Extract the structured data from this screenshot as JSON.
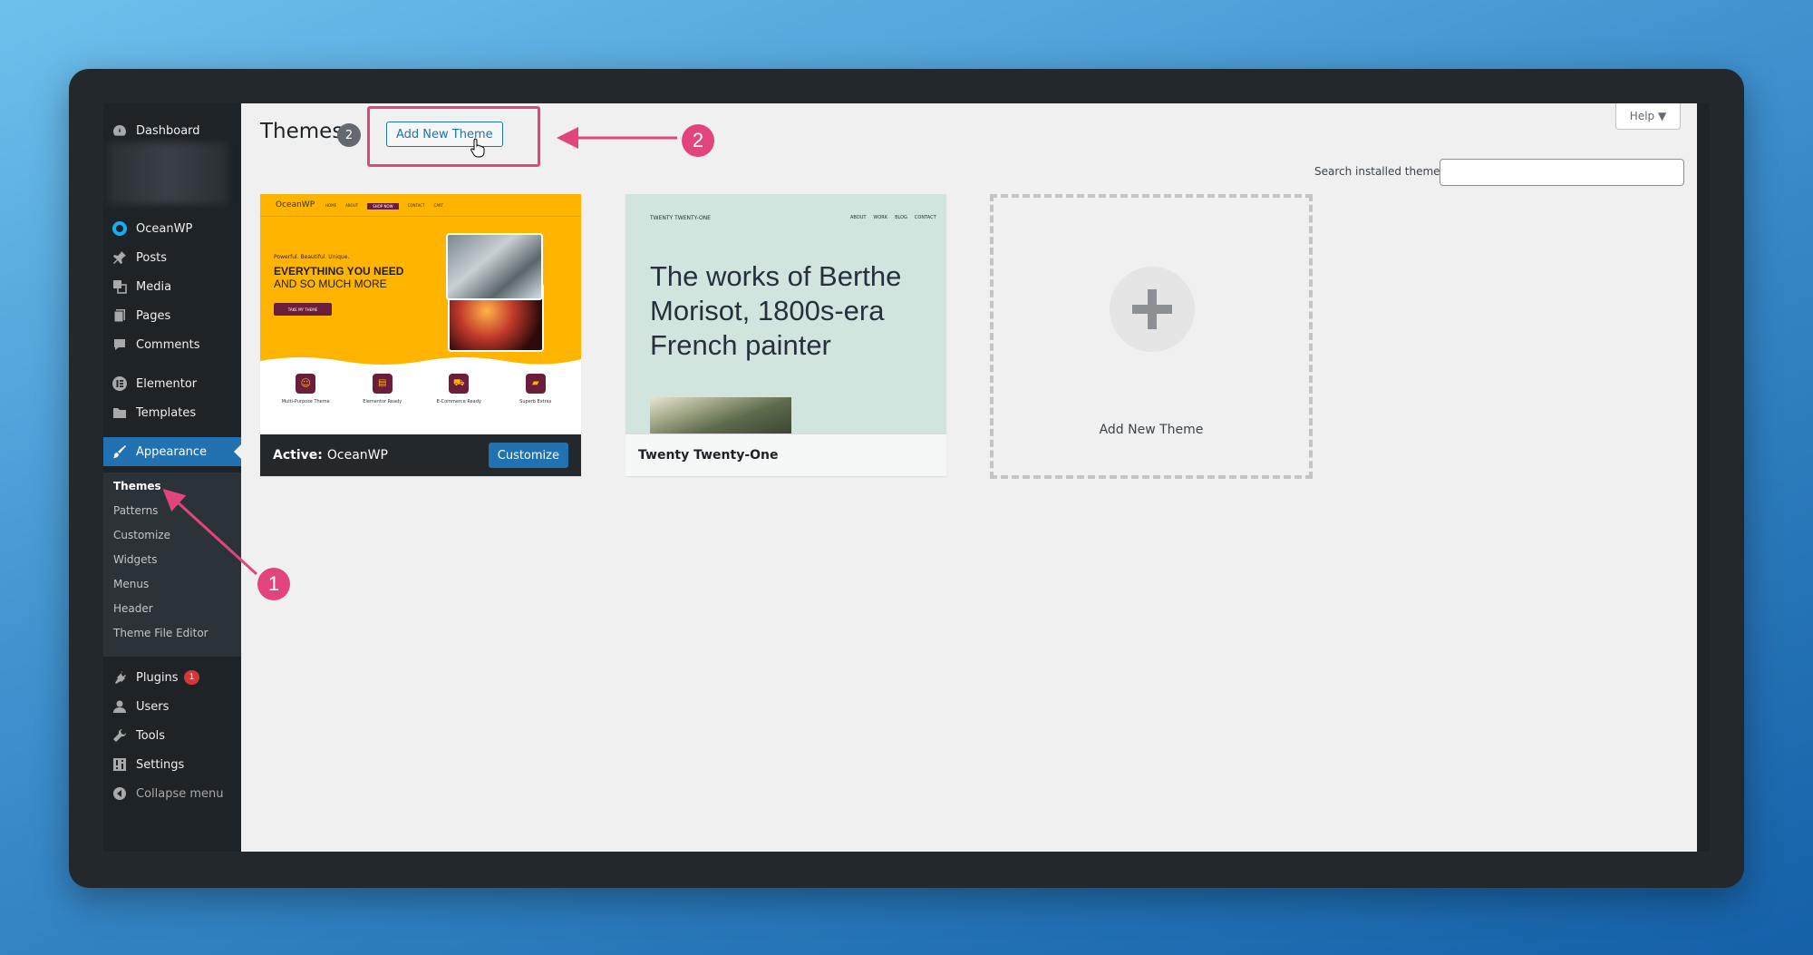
{
  "sidebar": {
    "items": [
      {
        "label": "Dashboard",
        "icon": "dashboard-icon"
      },
      {
        "label": "OceanWP",
        "icon": "oceanwp-icon"
      },
      {
        "label": "Posts",
        "icon": "pin-icon"
      },
      {
        "label": "Media",
        "icon": "media-icon"
      },
      {
        "label": "Pages",
        "icon": "pages-icon"
      },
      {
        "label": "Comments",
        "icon": "comment-icon"
      },
      {
        "label": "Elementor",
        "icon": "elementor-icon"
      },
      {
        "label": "Templates",
        "icon": "folder-icon"
      },
      {
        "label": "Appearance",
        "icon": "brush-icon"
      },
      {
        "label": "Plugins",
        "icon": "plugin-icon",
        "badge": "1"
      },
      {
        "label": "Users",
        "icon": "user-icon"
      },
      {
        "label": "Tools",
        "icon": "wrench-icon"
      },
      {
        "label": "Settings",
        "icon": "settings-icon"
      },
      {
        "label": "Collapse menu",
        "icon": "collapse-icon"
      }
    ],
    "submenu": [
      "Themes",
      "Patterns",
      "Customize",
      "Widgets",
      "Menus",
      "Header",
      "Theme File Editor"
    ]
  },
  "header": {
    "title": "Themes",
    "count": "2",
    "add_button": "Add New Theme",
    "help": "Help ▼",
    "search_label": "Search installed themes",
    "search_placeholder": ""
  },
  "themes": [
    {
      "active_prefix": "Active:",
      "name": "OceanWP",
      "customize": "Customize",
      "preview": {
        "logo": "OceanWP",
        "nav": [
          "HOME",
          "ABOUT",
          "SHOP NOW",
          "CONTACT",
          "CART"
        ],
        "kicker": "Powerful. Beautiful. Unique.",
        "headline1": "EVERYTHING YOU NEED",
        "headline2": "AND SO MUCH MORE",
        "cta": "TAKE MY THEME",
        "features": [
          "Multi-Purpose Theme",
          "Elementor Ready",
          "E-Commerce Ready",
          "Superb Extras"
        ]
      }
    },
    {
      "name": "Twenty Twenty-One",
      "preview": {
        "site": "TWENTY TWENTY-ONE",
        "nav": [
          "ABOUT",
          "WORK",
          "BLOG",
          "CONTACT"
        ],
        "heading": "The works of Berthe Morisot, 1800s-era French painter"
      }
    }
  ],
  "add_new_card": {
    "label": "Add New Theme"
  },
  "annotations": [
    "1",
    "2"
  ],
  "colors": {
    "accent": "#2271b1",
    "annotation": "#e2457e",
    "sidebar": "#1d2327",
    "ocean_yellow": "#ffb400",
    "tt1_bg": "#d1e4dd"
  }
}
